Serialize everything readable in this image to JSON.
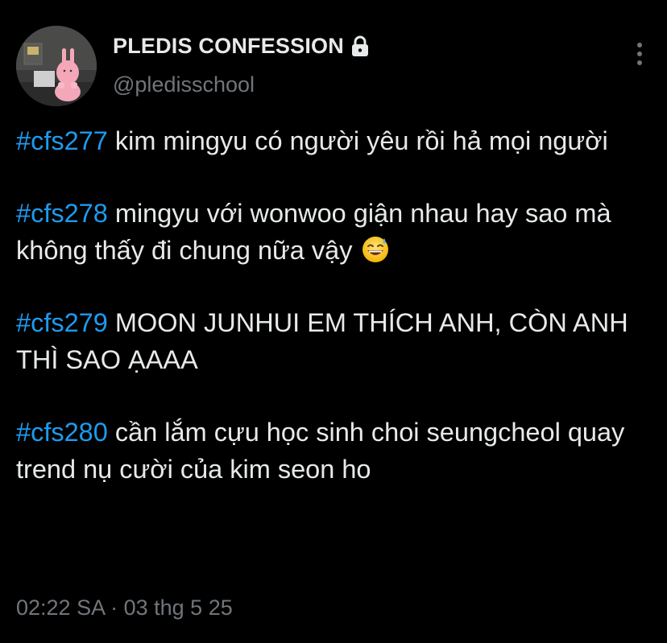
{
  "profile": {
    "display_name": "PLEDIS CONFESSION",
    "handle": "@pledisschool",
    "locked": true
  },
  "tweet": {
    "paragraphs": [
      {
        "hashtag": "#cfs277",
        "text": " kim mingyu có người yêu rồi hả mọi người",
        "emoji": ""
      },
      {
        "hashtag": "#cfs278",
        "text": " mingyu với wonwoo giận nhau hay sao mà không thấy đi chung nữa vậy ",
        "emoji": "grinning-sweat-emoji"
      },
      {
        "hashtag": "#cfs279",
        "text": " MOON JUNHUI EM THÍCH ANH, CÒN ANH THÌ SAO ẠAAA",
        "emoji": ""
      },
      {
        "hashtag": "#cfs280",
        "text": " cần lắm cựu học sinh choi seungcheol quay trend nụ cười của kim seon ho",
        "emoji": ""
      }
    ]
  },
  "meta": {
    "time": "02:22 SA",
    "separator": " · ",
    "date": "03 thg 5 25"
  },
  "colors": {
    "background": "#000000",
    "text": "#e7e9ea",
    "secondary": "#71767b",
    "hashtag": "#1d9bf0"
  }
}
